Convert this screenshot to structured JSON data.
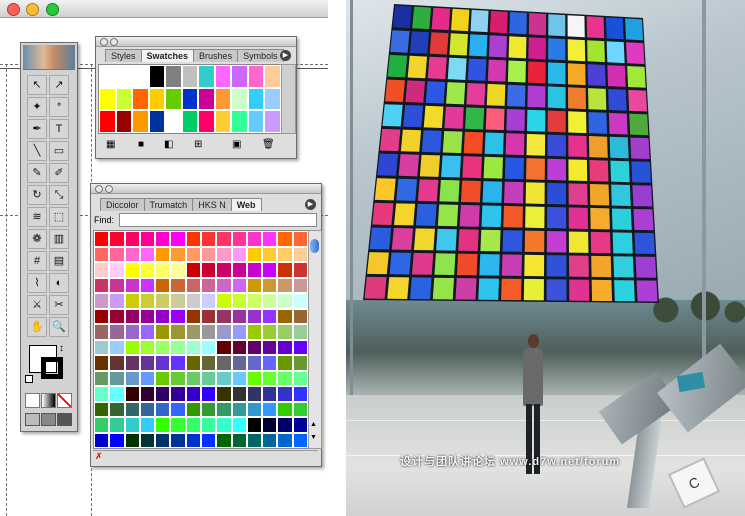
{
  "app": {
    "traffic_lights": [
      "#ff5f56",
      "#ffbd2e",
      "#27c93f"
    ]
  },
  "swatches_panel": {
    "tabs": [
      "Styles",
      "Swatches",
      "Brushes",
      "Symbols"
    ],
    "active_tab": "Swatches",
    "rows": [
      [
        "#ffffff",
        "#ffffff",
        "#ffffff",
        "#000000",
        "#808080",
        "#c0c0c0",
        "#33cccc",
        "#ff66ff",
        "#cc66ff",
        "#ff66cc",
        "#ffcc99"
      ],
      [
        "#ffff00",
        "#ccff33",
        "#ff6600",
        "#ffcc00",
        "#66cc00",
        "#0033cc",
        "#cc0099",
        "#ff9933",
        "#ccffcc",
        "#33ccff",
        "#99ccff"
      ],
      [
        "#ff0000",
        "#990000",
        "#ff9900",
        "#003399",
        "#ffffff",
        "#00cc66",
        "#ff0066",
        "#ffcc33",
        "#33ff99",
        "#66ccff",
        "#cc99ff"
      ]
    ]
  },
  "toolbox": {
    "icons": [
      "selection-arrow",
      "direct-select-arrow",
      "magic-wand",
      "lasso",
      "pen",
      "type",
      "line",
      "rectangle",
      "paintbrush",
      "pencil",
      "rotate",
      "scale",
      "warp",
      "free-transform",
      "symbol-sprayer",
      "graph",
      "mesh",
      "gradient",
      "eyedropper",
      "blend",
      "slice",
      "scissors",
      "hand",
      "zoom"
    ],
    "glyphs": [
      "↖",
      "↗",
      "✦",
      "ᐤ",
      "✒",
      "T",
      "╲",
      "▭",
      "✎",
      "✐",
      "↻",
      "⤡",
      "≋",
      "⬚",
      "❁",
      "▥",
      "#",
      "▤",
      "⌇",
      "◐",
      "⚔",
      "✂",
      "✋",
      "🔍"
    ]
  },
  "color_panel": {
    "tabs": [
      "Diccolor",
      "Trumatch",
      "HKS N",
      "Web"
    ],
    "active_tab": "Web",
    "find_label": "Find:",
    "find_value": "",
    "rows": [
      [
        "#ff0000",
        "#ff0033",
        "#ff0066",
        "#ff0099",
        "#ff00cc",
        "#ff00ff",
        "#ff3300",
        "#ff3333",
        "#ff3366",
        "#ff3399",
        "#ff33cc",
        "#ff33ff",
        "#ff6600",
        "#ff6633"
      ],
      [
        "#ff6666",
        "#ff6699",
        "#ff66cc",
        "#ff66ff",
        "#ff9900",
        "#ff9933",
        "#ff9966",
        "#ff9999",
        "#ff99cc",
        "#ff99ff",
        "#ffcc00",
        "#ffcc33",
        "#ffcc66",
        "#ffcc99"
      ],
      [
        "#ffcccc",
        "#ffccff",
        "#ffff00",
        "#ffff33",
        "#ffff66",
        "#ffff99",
        "#cc0000",
        "#cc0033",
        "#cc0066",
        "#cc0099",
        "#cc00cc",
        "#cc00ff",
        "#cc3300",
        "#cc3333"
      ],
      [
        "#cc3366",
        "#cc3399",
        "#cc33cc",
        "#cc33ff",
        "#cc6600",
        "#cc6633",
        "#cc6666",
        "#cc6699",
        "#cc66cc",
        "#cc66ff",
        "#cc9900",
        "#cc9933",
        "#cc9966",
        "#cc9999"
      ],
      [
        "#cc99cc",
        "#cc99ff",
        "#cccc00",
        "#cccc33",
        "#cccc66",
        "#cccc99",
        "#cccccc",
        "#ccccff",
        "#ccff00",
        "#ccff33",
        "#ccff66",
        "#ccff99",
        "#ccffcc",
        "#ccffff"
      ],
      [
        "#990000",
        "#990033",
        "#990066",
        "#990099",
        "#9900cc",
        "#9900ff",
        "#993300",
        "#993333",
        "#993366",
        "#993399",
        "#9933cc",
        "#9933ff",
        "#996600",
        "#996633"
      ],
      [
        "#996666",
        "#996699",
        "#9966cc",
        "#9966ff",
        "#999900",
        "#999933",
        "#999966",
        "#999999",
        "#9999cc",
        "#9999ff",
        "#99cc00",
        "#99cc33",
        "#99cc66",
        "#99cc99"
      ],
      [
        "#99cccc",
        "#99ccff",
        "#99ff00",
        "#99ff33",
        "#99ff66",
        "#99ff99",
        "#99ffcc",
        "#99ffff",
        "#660000",
        "#660033",
        "#660066",
        "#660099",
        "#6600cc",
        "#6600ff"
      ],
      [
        "#663300",
        "#663333",
        "#663366",
        "#663399",
        "#6633cc",
        "#6633ff",
        "#666600",
        "#666633",
        "#666666",
        "#666699",
        "#6666cc",
        "#6666ff",
        "#669900",
        "#669933"
      ],
      [
        "#669966",
        "#669999",
        "#6699cc",
        "#6699ff",
        "#66cc00",
        "#66cc33",
        "#66cc66",
        "#66cc99",
        "#66cccc",
        "#66ccff",
        "#66ff00",
        "#66ff33",
        "#66ff66",
        "#66ff99"
      ],
      [
        "#66ffcc",
        "#66ffff",
        "#330000",
        "#330033",
        "#330066",
        "#330099",
        "#3300cc",
        "#3300ff",
        "#333300",
        "#333333",
        "#333366",
        "#333399",
        "#3333cc",
        "#3333ff"
      ],
      [
        "#336600",
        "#336633",
        "#336666",
        "#336699",
        "#3366cc",
        "#3366ff",
        "#339900",
        "#339933",
        "#339966",
        "#339999",
        "#3399cc",
        "#3399ff",
        "#33cc00",
        "#33cc33"
      ],
      [
        "#33cc66",
        "#33cc99",
        "#33cccc",
        "#33ccff",
        "#33ff00",
        "#33ff33",
        "#33ff66",
        "#33ff99",
        "#33ffcc",
        "#33ffff",
        "#000000",
        "#000033",
        "#000066",
        "#000099"
      ],
      [
        "#0000cc",
        "#0000ff",
        "#003300",
        "#003333",
        "#003366",
        "#003399",
        "#0033cc",
        "#0033ff",
        "#006600",
        "#006633",
        "#006666",
        "#006699",
        "#0066cc",
        "#0066ff"
      ]
    ]
  },
  "wall": {
    "rows": [
      [
        "#1a2fa0",
        "#2eae3c",
        "#e62a8a",
        "#f3d21a",
        "#8fd1f0",
        "#d61d6e",
        "#2d66e0",
        "#cc3391",
        "#6fc4ea",
        "#f5f5f5",
        "#e8348c",
        "#1850d8",
        "#20a0e0"
      ],
      [
        "#3a6de0",
        "#203fb8",
        "#e03a3a",
        "#d1e62d",
        "#2ab0f0",
        "#aa3fd0",
        "#f0e82a",
        "#cf1f8f",
        "#2a7ae8",
        "#f0f03a",
        "#a5e42e",
        "#6fd7ff",
        "#e03ac0"
      ],
      [
        "#21b03f",
        "#f2d42a",
        "#e83a90",
        "#7ed9f4",
        "#2e54e0",
        "#d33ab2",
        "#a8f04a",
        "#e9233b",
        "#29b8e8",
        "#f6a827",
        "#4c40d8",
        "#d32fb0",
        "#a2e83a"
      ],
      [
        "#f34f27",
        "#cf2a7d",
        "#2f57e5",
        "#9ee94a",
        "#e23e9a",
        "#f0d725",
        "#3d6ae6",
        "#b13ed2",
        "#2ac3e3",
        "#f07d2d",
        "#b6e63a",
        "#2f4bd7",
        "#e7499c"
      ],
      [
        "#4fd0f5",
        "#2c51d8",
        "#f1dc2b",
        "#e2399a",
        "#2fb646",
        "#fa5d7b",
        "#a93ed5",
        "#2ad5e8",
        "#e23d3d",
        "#f1f134",
        "#2f66e0",
        "#cb38c2",
        "#4eaa3c"
      ],
      [
        "#e23d8a",
        "#f2d12a",
        "#2b58dd",
        "#9ae14a",
        "#f54b27",
        "#2cc1eb",
        "#d737aa",
        "#f3e93a",
        "#3b4bd9",
        "#e6328c",
        "#f09e2a",
        "#2dbad9",
        "#a33ecc"
      ],
      [
        "#2e46d2",
        "#d53fa2",
        "#f0ce29",
        "#39c0f0",
        "#ec3380",
        "#9be842",
        "#2857e3",
        "#f37230",
        "#bc3ed5",
        "#f5ea2e",
        "#e63c7a",
        "#2ed1d9",
        "#2a52d9"
      ],
      [
        "#f9c72a",
        "#2f6ae2",
        "#e43a8d",
        "#8ae34a",
        "#f24d2a",
        "#2bb3eb",
        "#c53eb9",
        "#f2e435",
        "#2b4ed6",
        "#df3f8c",
        "#f0a428",
        "#31c7df",
        "#9a3ed1"
      ],
      [
        "#e73a7d",
        "#f5d52b",
        "#2a60e0",
        "#94e547",
        "#cf3ba9",
        "#2fc2ec",
        "#f35928",
        "#e9f035",
        "#3b51db",
        "#df3292",
        "#f7ab2c",
        "#2bd0db",
        "#aa3fd4"
      ],
      [
        "#2b5ddf",
        "#db3e9d",
        "#f1d62c",
        "#3ec8ec",
        "#e5327f",
        "#a6e84c",
        "#2f56e0",
        "#f47829",
        "#c43ed3",
        "#f1e634",
        "#e73984",
        "#2ecfe0",
        "#2c54dc"
      ],
      [
        "#f5c82a",
        "#2e67e3",
        "#df3a8a",
        "#8de44c",
        "#f14a2b",
        "#2cb7ee",
        "#c93db5",
        "#f5e430",
        "#2f52d8",
        "#e23f8b",
        "#f1a52a",
        "#33cde0",
        "#9d3fd2"
      ],
      [
        "#dd3b7c",
        "#f5d62c",
        "#2b62df",
        "#96e449",
        "#cd3ea6",
        "#2fc4ed",
        "#f45c28",
        "#e8ef36",
        "#3b53d9",
        "#e0328f",
        "#f6ad2b",
        "#2cd2dd",
        "#ad3ed6"
      ]
    ]
  },
  "watermark": "设计与团队讲论坛 www.d7w.net/forum"
}
